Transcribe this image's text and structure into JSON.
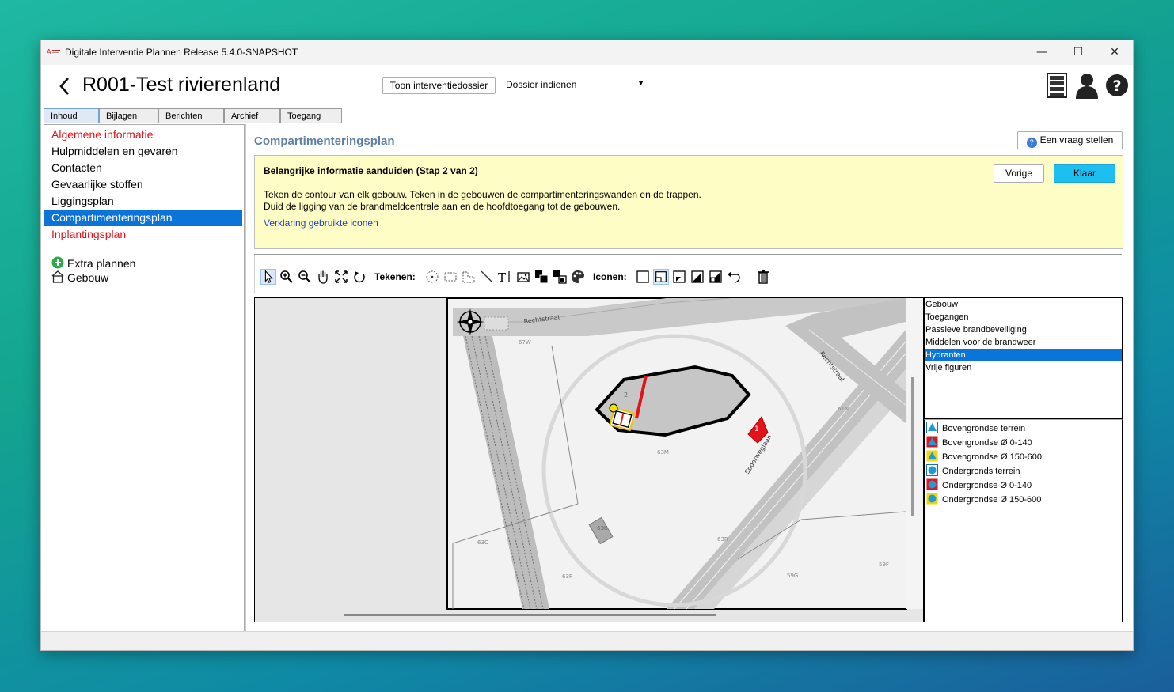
{
  "window": {
    "title": "Digitale Interventie Plannen Release 5.4.0-SNAPSHOT",
    "minimize": "—",
    "maximize": "☐",
    "close": "✕"
  },
  "header": {
    "title": "R001-Test rivierenland",
    "toon_button": "Toon interventiedossier",
    "dossier_select": "Dossier indienen",
    "icons": [
      "cabinet-icon",
      "user-icon",
      "help-icon"
    ]
  },
  "tabs": [
    "Inhoud",
    "Bijlagen",
    "Berichten",
    "Archief",
    "Toegang"
  ],
  "sidebar": {
    "items": [
      {
        "label": "Algemene informatie",
        "state": "red"
      },
      {
        "label": "Hulpmiddelen en gevaren",
        "state": "normal"
      },
      {
        "label": "Contacten",
        "state": "normal"
      },
      {
        "label": "Gevaarlijke stoffen",
        "state": "normal"
      },
      {
        "label": "Liggingsplan",
        "state": "normal"
      },
      {
        "label": "Compartimenteringsplan",
        "state": "selected"
      },
      {
        "label": "Inplantingsplan",
        "state": "red"
      }
    ],
    "extra_plans": "Extra plannen",
    "building": "Gebouw"
  },
  "main": {
    "section_title": "Compartimenteringsplan",
    "ask_button": "Een vraag stellen",
    "info": {
      "heading": "Belangrijke informatie aanduiden (Stap 2 van 2)",
      "line1": "Teken de contour van elk gebouw. Teken in de gebouwen de compartimenteringswanden en de trappen.",
      "line2": "Duid de ligging van de brandmeldcentrale aan en de hoofdtoegang tot de gebouwen.",
      "link": "Verklaring gebruikte iconen",
      "prev_button": "Vorige",
      "done_button": "Klaar"
    },
    "toolbar": {
      "draw_label": "Tekenen:",
      "icons_label": "Iconen:"
    },
    "map": {
      "street_labels": [
        "Rechtstraat",
        "Rechtstraat",
        "Spoorweglaan"
      ],
      "parcel_labels": [
        "67W",
        "63M",
        "63K",
        "63C",
        "63F",
        "63R",
        "61N",
        "59G",
        "59F"
      ],
      "building_number": "2",
      "marker_number": "1"
    },
    "layers": [
      "Gebouw",
      "Toegangen",
      "Passieve brandbeveiliging",
      "Middelen voor de brandweer",
      "Hydranten",
      "Vrije figuren"
    ],
    "selected_layer": "Hydranten",
    "hydrant_icons": [
      "Bovengrondse terrein",
      "Bovengrondse Ø 0-140",
      "Bovengrondse Ø 150-600",
      "Ondergronds terrein",
      "Ondergrondse Ø 0-140",
      "Ondergrondse Ø 150-600"
    ]
  },
  "colors": {
    "accent": "#0a74d8",
    "warning_text": "#e0131a",
    "info_bg": "#fffdc6",
    "done_button": "#1dbef0",
    "section_title": "#5d7fa5"
  }
}
